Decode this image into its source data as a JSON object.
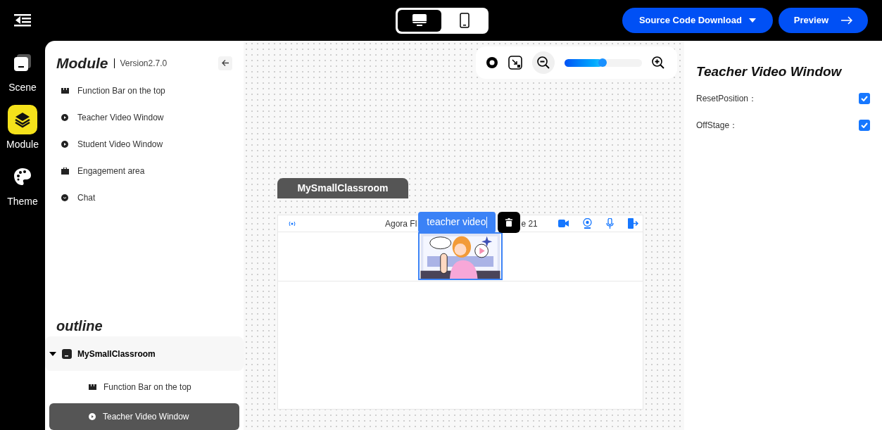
{
  "topbar": {
    "devices": [
      {
        "kind": "desktop",
        "selected": true
      },
      {
        "kind": "mobile",
        "selected": false
      }
    ],
    "download_button": "Source Code Download",
    "preview_button": "Preview"
  },
  "rail": [
    {
      "kind": "scene",
      "label": "Scene",
      "selected": false
    },
    {
      "kind": "module",
      "label": "Module",
      "selected": true
    },
    {
      "kind": "theme",
      "label": "Theme",
      "selected": false
    }
  ],
  "module_panel": {
    "title": "Module",
    "version": "Version2.7.0",
    "items": [
      {
        "kind": "bar",
        "label": "Function Bar on the top"
      },
      {
        "kind": "video",
        "label": "Teacher Video Window"
      },
      {
        "kind": "video",
        "label": "Student Video Window"
      },
      {
        "kind": "case",
        "label": "Engagement area"
      },
      {
        "kind": "chat",
        "label": "Chat"
      }
    ]
  },
  "outline": {
    "title": "outline",
    "tree": [
      {
        "label": "MySmallClassroom",
        "expanded": true,
        "children": [
          {
            "kind": "bar",
            "label": "Function Bar on the top",
            "selected": false
          },
          {
            "kind": "video",
            "label": "Teacher Video Window",
            "selected": true
          }
        ]
      }
    ]
  },
  "canvas": {
    "zoom": {
      "level": 0.49
    },
    "classroom_tab": "MySmallClassroom",
    "header_title_start": "Agora Fl",
    "header_title_end": "e 21",
    "selected_label": "teacher video"
  },
  "properties": {
    "title": "Teacher Video Window",
    "options": [
      {
        "label": "ResetPosition：",
        "checked": true
      },
      {
        "label": "OffStage：",
        "checked": true
      }
    ]
  }
}
